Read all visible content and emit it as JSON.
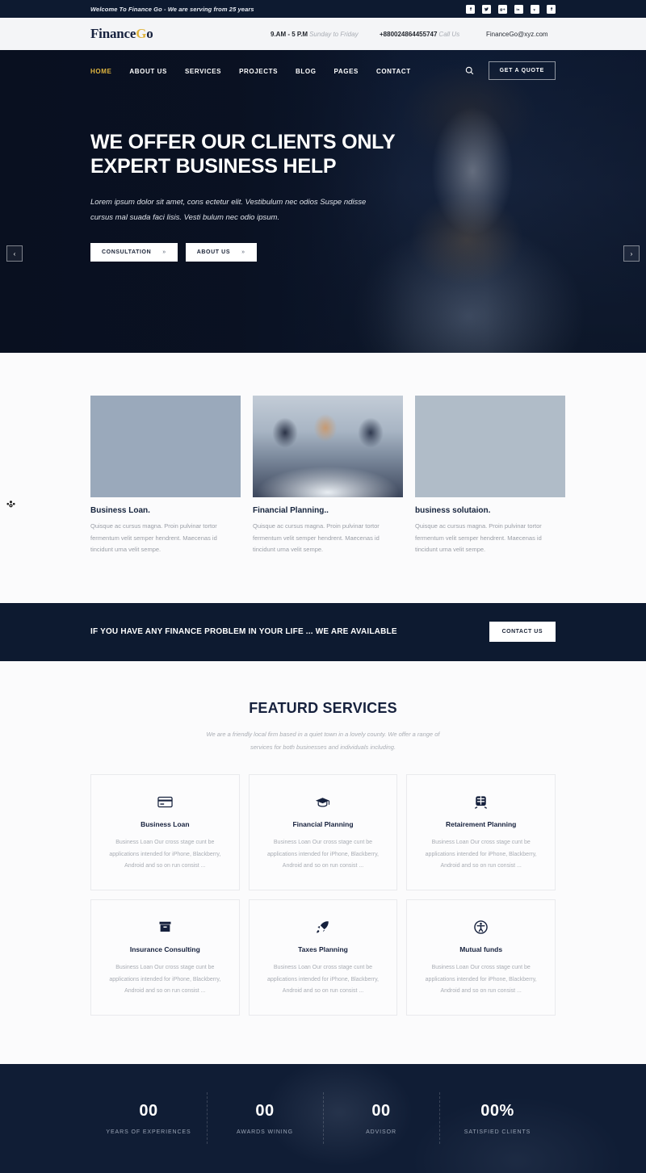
{
  "topbar": {
    "welcome": "Welcome To Finance Go - We are serving from 25 years",
    "social": [
      {
        "name": "facebook-icon",
        "glyph": "f"
      },
      {
        "name": "twitter-icon",
        "glyph": "ᵛ"
      },
      {
        "name": "google-plus-icon",
        "glyph": "g+"
      },
      {
        "name": "linkedin-icon",
        "glyph": "in"
      },
      {
        "name": "vimeo-icon",
        "glyph": "v"
      },
      {
        "name": "facebook-icon-2",
        "glyph": "f"
      }
    ]
  },
  "header": {
    "logo_main": "Finance",
    "logo_accent": "G",
    "logo_tail": "o",
    "hours": "9.AM - 5 P.M",
    "hours_sub": "Sunday to Friday",
    "phone": "+880024864455747",
    "phone_sub": "Call Us",
    "email": "FinanceGo@xyz.com"
  },
  "nav": {
    "items": [
      {
        "label": "HOME",
        "active": true
      },
      {
        "label": "ABOUT US",
        "active": false
      },
      {
        "label": "SERVICES",
        "active": false
      },
      {
        "label": "PROJECTS",
        "active": false
      },
      {
        "label": "BLOG",
        "active": false
      },
      {
        "label": "PAGES",
        "active": false
      },
      {
        "label": "CONTACT",
        "active": false
      }
    ],
    "quote_button": "GET A QUOTE"
  },
  "hero": {
    "title": "WE OFFER OUR CLIENTS ONLY EXPERT BUSINESS HELP",
    "subtitle": "Lorem ipsum dolor sit amet, cons ectetur elit. Vestibulum nec odios Suspe ndisse cursus mal suada faci lisis. Vesti bulum nec odio ipsum.",
    "btn_primary": "CONSULTATION",
    "btn_secondary": "ABOUT US",
    "chevron": "»",
    "arrow_left": "‹",
    "arrow_right": "›"
  },
  "cards": [
    {
      "title": "Business Loan.",
      "text": "Quisque ac cursus magna. Proin pulvinar tortor fermentum velit semper hendrent. Maecenas id tincidunt urna velit sempe."
    },
    {
      "title": "Financial Planning..",
      "text": "Quisque ac cursus magna. Proin pulvinar tortor fermentum velit semper hendrent. Maecenas id tincidunt urna velit sempe."
    },
    {
      "title": "business solutaion.",
      "text": "Quisque ac cursus magna. Proin pulvinar tortor fermentum velit semper hendrent. Maecenas id tincidunt urna velit sempe."
    }
  ],
  "cta": {
    "text": "IF YOU HAVE ANY FINANCE PROBLEM IN YOUR LIFE ... WE ARE AVAILABLE",
    "button": "CONTACT US"
  },
  "features": {
    "title": "FEATURD SERVICES",
    "subtitle": "We are a friendly local firm based in a quiet town in a lovely county. We offer a range of services for both businesses and individuals including.",
    "items": [
      {
        "icon": "credit-card-icon",
        "title": "Business Loan",
        "text": "Business Loan Our cross stage cunt be applications intended for iPhone, Blackberry, Android and so on run consist ..."
      },
      {
        "icon": "graduation-cap-icon",
        "title": "Financial Planning",
        "text": "Business Loan Our cross stage cunt be applications intended for iPhone, Blackberry, Android and so on run consist ..."
      },
      {
        "icon": "train-icon",
        "title": "Retairement Planning",
        "text": "Business Loan Our cross stage cunt be applications intended for iPhone, Blackberry, Android and so on run consist ..."
      },
      {
        "icon": "archive-box-icon",
        "title": "Insurance Consulting",
        "text": "Business Loan Our cross stage cunt be applications intended for iPhone, Blackberry, Android and so on run consist ..."
      },
      {
        "icon": "rocket-icon",
        "title": "Taxes Planning",
        "text": "Business Loan Our cross stage cunt be applications intended for iPhone, Blackberry, Android and so on run consist ..."
      },
      {
        "icon": "accessibility-icon",
        "title": "Mutual funds",
        "text": "Business Loan Our cross stage cunt be applications intended for iPhone, Blackberry, Android and so on run consist ..."
      }
    ]
  },
  "counters": [
    {
      "value": "00",
      "label": "YEARS OF EXPERIENCES"
    },
    {
      "value": "00",
      "label": "AWARDS WINING"
    },
    {
      "value": "00",
      "label": "ADVISOR"
    },
    {
      "value": "00%",
      "label": "SATISFIED CLIENTS"
    }
  ],
  "colors": {
    "dark_navy": "#0d1a30",
    "accent_gold": "#e0b540",
    "light_bg": "#fbfbfc",
    "muted_text": "#a9adb4"
  }
}
